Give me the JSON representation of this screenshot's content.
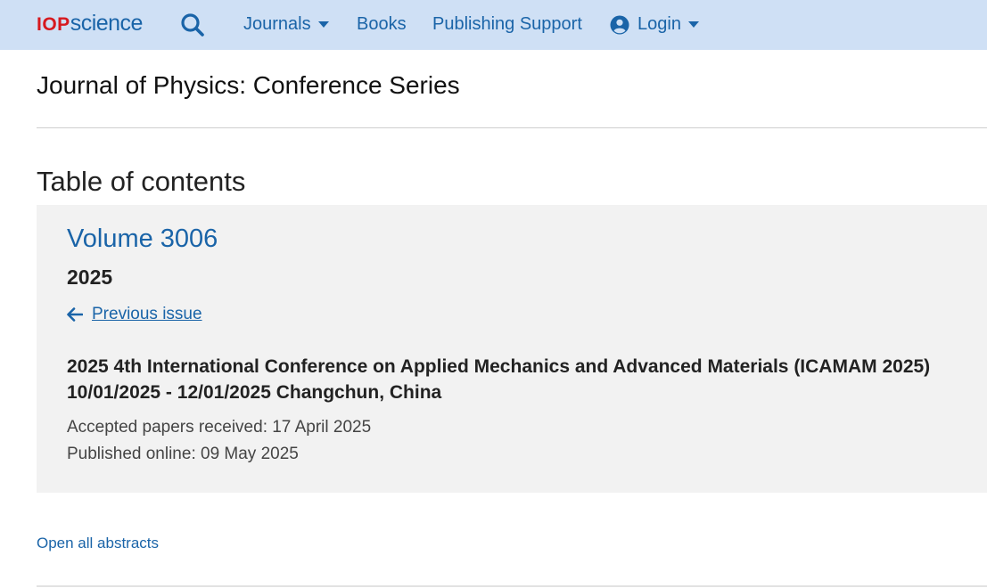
{
  "header": {
    "logo_iop": "IOP",
    "logo_science": "science",
    "nav": {
      "journals": "Journals",
      "books": "Books",
      "publishing_support": "Publishing Support",
      "login": "Login"
    }
  },
  "journal_title": "Journal of Physics: Conference Series",
  "toc_heading": "Table of contents",
  "issue": {
    "volume": "Volume 3006",
    "year": "2025",
    "previous_issue": "Previous issue",
    "conference_line1": "2025 4th International Conference on Applied Mechanics and Advanced Materials (ICAMAM 2025)",
    "conference_line2": "10/01/2025 - 12/01/2025 Changchun, China",
    "accepted": "Accepted papers received: 17 April 2025",
    "published": "Published online: 09 May 2025"
  },
  "open_all_abstracts": "Open all abstracts",
  "colors": {
    "header_bg": "#cfe0f5",
    "link_blue": "#1a64a8",
    "logo_red": "#d7191f",
    "panel_bg": "#f2f2f2"
  },
  "icons": [
    "search-icon",
    "caret-down-icon",
    "user-circle-icon",
    "arrow-left-icon"
  ]
}
